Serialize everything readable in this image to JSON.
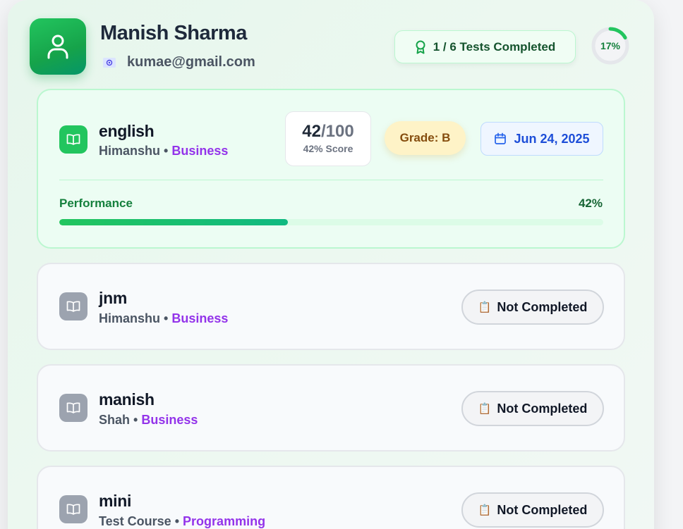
{
  "profile": {
    "name": "Manish Sharma",
    "email": "kumae@gmail.com",
    "avatar_icon": "user-icon",
    "email_icon": "email-icon"
  },
  "summary": {
    "tests_completed_label": "1 / 6 Tests Completed",
    "completion_percent": 17,
    "completion_label": "17%",
    "accent_color": "#22c55e"
  },
  "tests": [
    {
      "subject": "english",
      "instructor": "Himanshu",
      "separator": "•",
      "category": "Business",
      "completed": true,
      "score": "42",
      "total": "/100",
      "score_label": "42% Score",
      "grade_label": "Grade: B",
      "date": "Jun 24, 2025",
      "performance_label": "Performance",
      "performance_value": "42%",
      "performance_percent": 42
    },
    {
      "subject": "jnm",
      "instructor": "Himanshu",
      "separator": "•",
      "category": "Business",
      "completed": false,
      "status_label": "Not Completed",
      "status_icon": "📋"
    },
    {
      "subject": "manish",
      "instructor": "Shah",
      "separator": "•",
      "category": "Business",
      "completed": false,
      "status_label": "Not Completed",
      "status_icon": "📋"
    },
    {
      "subject": "mini",
      "instructor": "Test Course",
      "separator": "•",
      "category": "Programming",
      "completed": false,
      "status_label": "Not Completed",
      "status_icon": "📋"
    }
  ]
}
